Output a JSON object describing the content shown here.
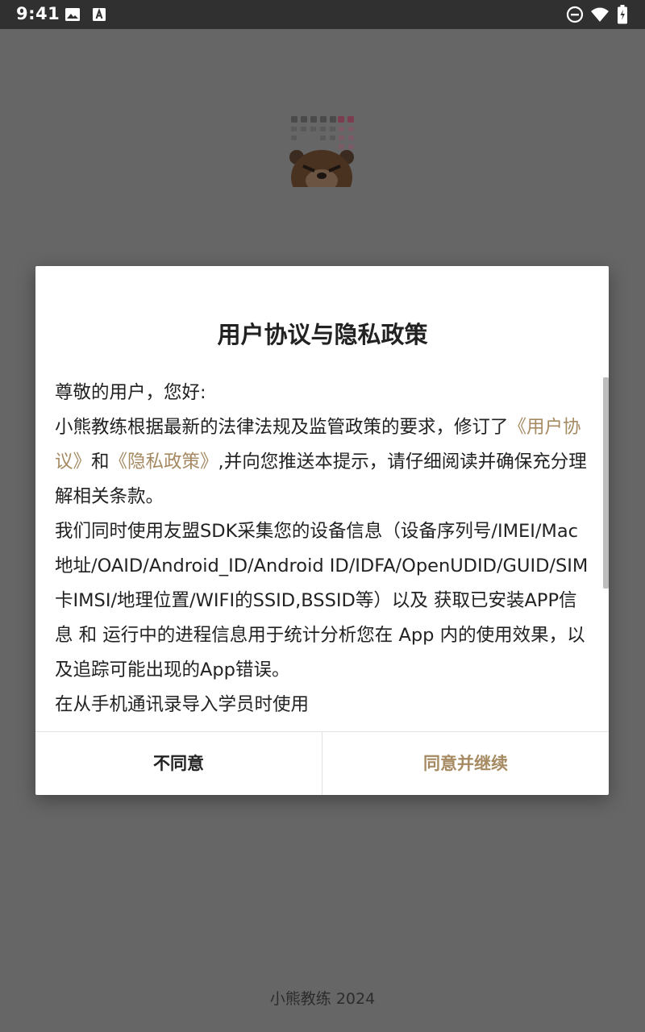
{
  "status_bar": {
    "time": "9:41",
    "icons": [
      "image-icon",
      "font-download-icon",
      "do-not-disturb-icon",
      "wifi-icon",
      "battery-icon"
    ]
  },
  "splash": {
    "logo_icon": "bear-calendar-logo",
    "copyright": "小熊教练 2024"
  },
  "dialog": {
    "title": "用户协议与隐私政策",
    "body": {
      "greeting": "尊敬的用户，您好:",
      "p1_part1": "小熊教练根据最新的法律法规及监管政策的要求，修订了",
      "user_agreement_link": "《用户协议》",
      "p1_and": "和",
      "privacy_policy_link": "《隐私政策》",
      "p1_part2": ",并向您推送本提示，请仔细阅读并确保充分理解相关条款。",
      "p2": "我们同时使用友盟SDK采集您的设备信息（设备序列号/IMEI/Mac地址/OAID/Android_ID/Android ID/IDFA/OpenUDID/GUID/SIM卡IMSI/地理位置/WIFI的SSID,BSSID等）以及 获取已安装APP信息 和 运行中的进程信息用于统计分析您在 App 内的使用效果，以及追踪可能出现的App错误。",
      "p3": "在从手机通讯录导入学员时使用"
    },
    "buttons": {
      "disagree": "不同意",
      "agree": "同意并继续"
    }
  },
  "colors": {
    "accent": "#a68a62",
    "overlay": "#666666",
    "status_bar": "#303030"
  }
}
